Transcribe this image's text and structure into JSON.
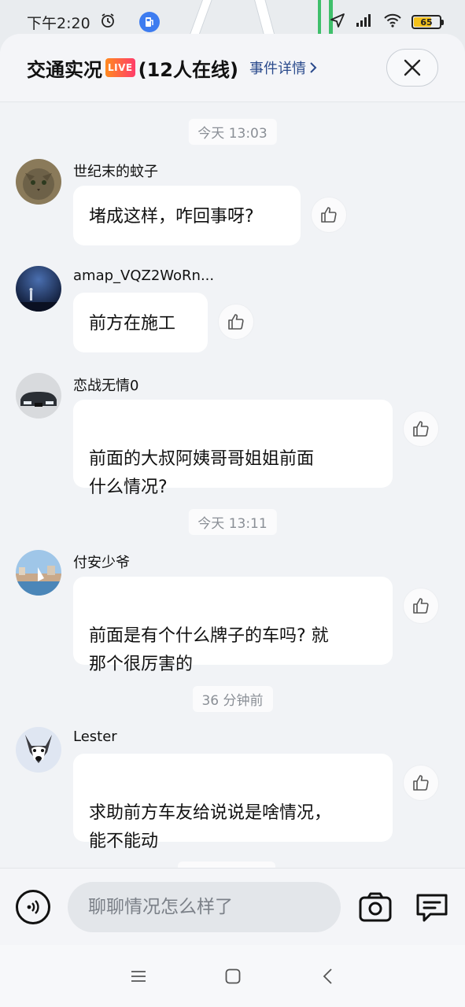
{
  "status_bar": {
    "time": "下午2:20",
    "battery": "65"
  },
  "header": {
    "title": "交通实况",
    "live_badge": "LIVE",
    "online_count": "(12人在线)",
    "event_link": "事件详情"
  },
  "messages": [
    {
      "time": "今天 13:03",
      "user": "世纪末的蚊子",
      "text": "堵成这样，咋回事呀?"
    },
    {
      "user": "amap_VQZ2WoRn...",
      "text": "前方在施工"
    },
    {
      "user": "恋战无情0",
      "text": "前面的大叔阿姨哥哥姐姐前面\n什么情况?"
    },
    {
      "time": "今天 13:11",
      "user": "付安少爷",
      "text": "前面是有个什么牌子的车吗? 就\n那个很厉害的"
    },
    {
      "time": "36 分钟前",
      "user": "Lester",
      "text": "求助前方车友给说说是啥情况，\n能不能动"
    }
  ],
  "input": {
    "placeholder": "聊聊情况怎么样了"
  },
  "colors": {
    "accent_link": "#2a4a8c",
    "live_gradient_start": "#ff8a1f",
    "live_gradient_end": "#ff3d6b",
    "sheet_bg": "#f1f3f6"
  }
}
